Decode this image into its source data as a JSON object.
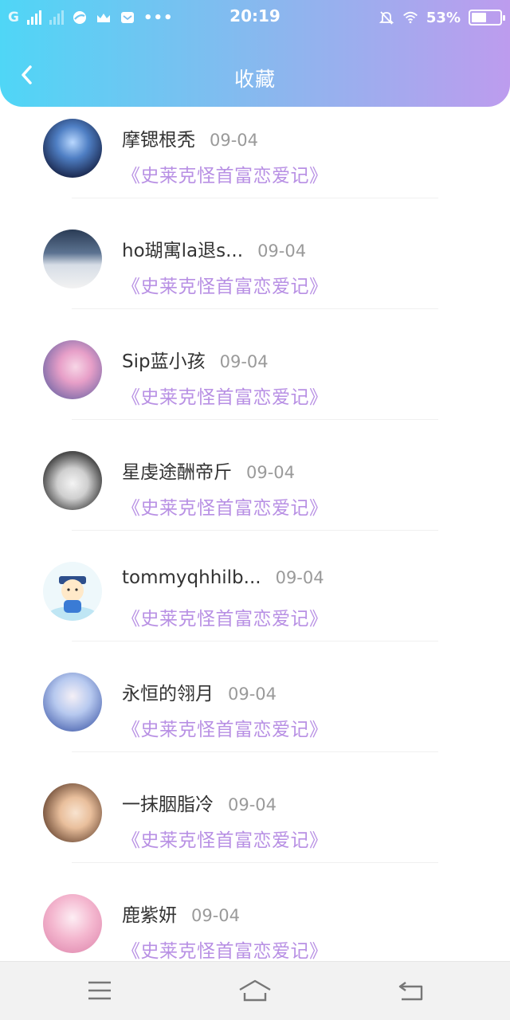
{
  "status_bar": {
    "carrier": "G",
    "time": "20:19",
    "battery_percent": "53%",
    "battery_level": 0.53,
    "icons": [
      "signal-icon",
      "signal-icon",
      "browser-icon",
      "crown-icon",
      "mail-icon",
      "more-dots-icon",
      "mute-bell-icon",
      "wifi-icon",
      "battery-icon"
    ]
  },
  "nav": {
    "title": "收藏",
    "back_icon": "chevron-left-icon"
  },
  "items": [
    {
      "name": "摩锶根秃",
      "date": "09-04",
      "book": "《史莱克怪首富恋爱记》",
      "avatar": "knight-avatar"
    },
    {
      "name": "ho瑚寓la退s...",
      "date": "09-04",
      "book": "《史莱克怪首富恋爱记》",
      "avatar": "snowfield-avatar"
    },
    {
      "name": "Sip蓝小孩",
      "date": "09-04",
      "book": "《史莱克怪首富恋爱记》",
      "avatar": "anime-girl-avatar"
    },
    {
      "name": "星虔途酬帝斤",
      "date": "09-04",
      "book": "《史莱克怪首富恋爱记》",
      "avatar": "cat-avatar"
    },
    {
      "name": "tommyqhhilb...",
      "date": "09-04",
      "book": "《史莱克怪首富恋爱记》",
      "avatar": "cartoon-official-avatar"
    },
    {
      "name": "永恒的翎月",
      "date": "09-04",
      "book": "《史莱克怪首富恋爱记》",
      "avatar": "anime-blue-hair-avatar"
    },
    {
      "name": "一抹胭脂冷",
      "date": "09-04",
      "book": "《史莱克怪首富恋爱记》",
      "avatar": "ancient-lady-avatar"
    },
    {
      "name": "鹿紫妍",
      "date": "09-04",
      "book": "《史莱克怪首富恋爱记》",
      "avatar": "pink-anime-avatar"
    }
  ],
  "bottom_bar": {
    "icons": [
      "menu-icon",
      "home-icon",
      "back-arrow-icon"
    ]
  }
}
